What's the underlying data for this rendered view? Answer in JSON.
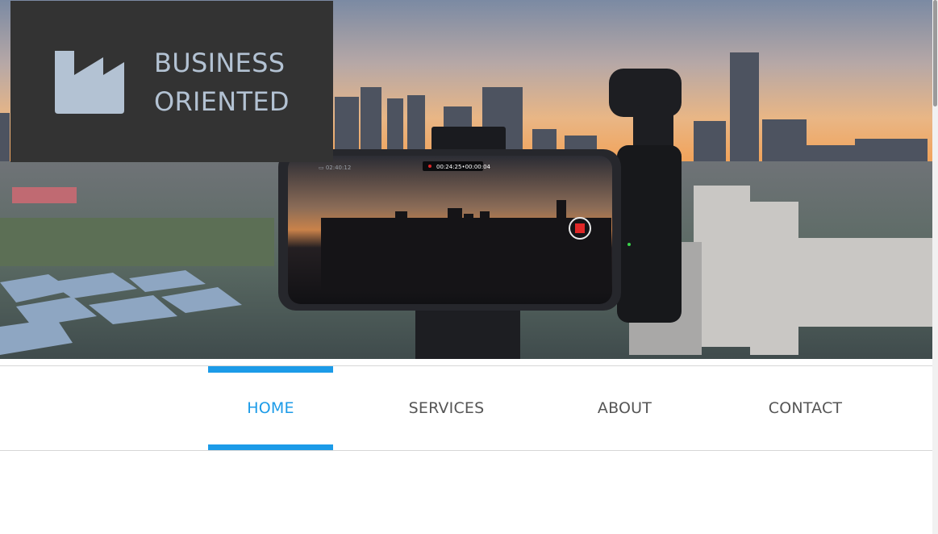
{
  "brand": {
    "line1": "BUSINESS",
    "line2": "ORIENTED",
    "icon": "factory-icon"
  },
  "hero": {
    "image": "city-sunset-phone-gimbal-photo",
    "phone_recording_time": "00:24:25",
    "phone_recording_elapsed": "00:00:04",
    "phone_clock": "02:40:12"
  },
  "nav": {
    "items": [
      {
        "label": "HOME",
        "active": true
      },
      {
        "label": "SERVICES",
        "active": false
      },
      {
        "label": "ABOUT",
        "active": false
      },
      {
        "label": "CONTACT",
        "active": false
      }
    ]
  },
  "colors": {
    "accent": "#1c9be8",
    "logo_bg": "#333333",
    "logo_fg": "#b3c2d3",
    "nav_text": "#555555"
  }
}
